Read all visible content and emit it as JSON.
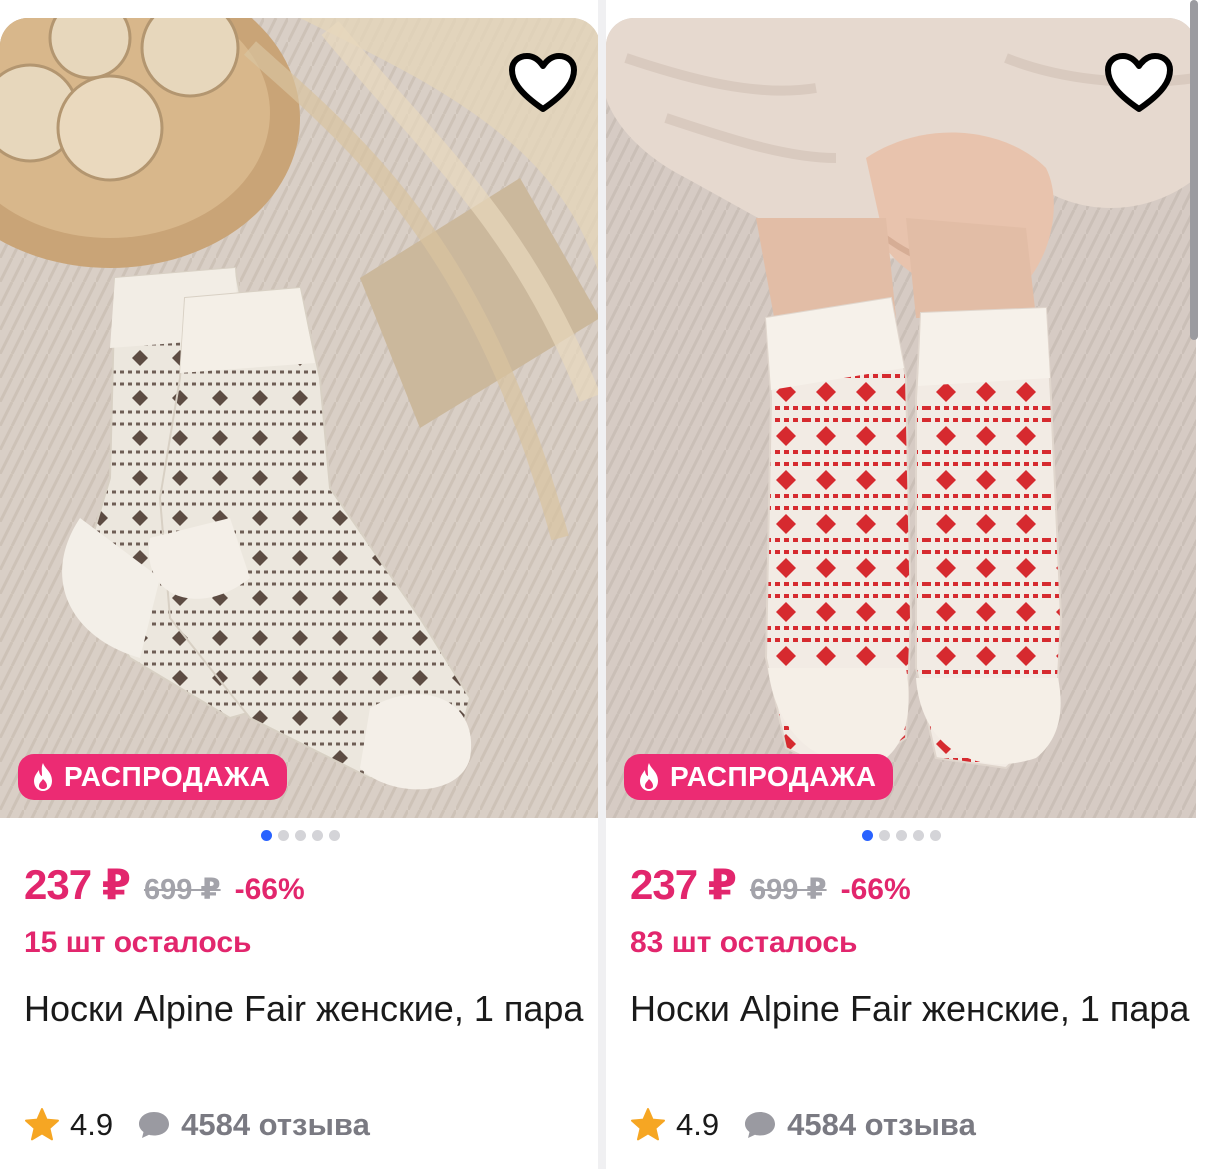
{
  "colors": {
    "accent": "#e2266d",
    "sale_badge_bg": "#ec2b73",
    "active_dot": "#2962ff",
    "muted_text": "#a3a3aa",
    "star": "#f6a623"
  },
  "products": [
    {
      "image_icon": "product-photo-socks-grey",
      "favorite_icon": "heart-icon",
      "badge": {
        "icon": "fire-icon",
        "label": "РАСПРОДАЖА"
      },
      "carousel": {
        "count": 5,
        "active": 0
      },
      "price_current": "237 ₽",
      "price_old": "699 ₽",
      "discount": "-66%",
      "stock": "15 шт осталось",
      "title": "Носки Alpine Fair женские, 1 пара",
      "rating": "4.9",
      "reviews": "4584 отзыва"
    },
    {
      "image_icon": "product-photo-socks-red",
      "favorite_icon": "heart-icon",
      "badge": {
        "icon": "fire-icon",
        "label": "РАСПРОДАЖА"
      },
      "carousel": {
        "count": 5,
        "active": 0
      },
      "price_current": "237 ₽",
      "price_old": "699 ₽",
      "discount": "-66%",
      "stock": "83 шт осталось",
      "title": "Носки Alpine Fair женские, 1 пара",
      "rating": "4.9",
      "reviews": "4584 отзыва"
    }
  ]
}
